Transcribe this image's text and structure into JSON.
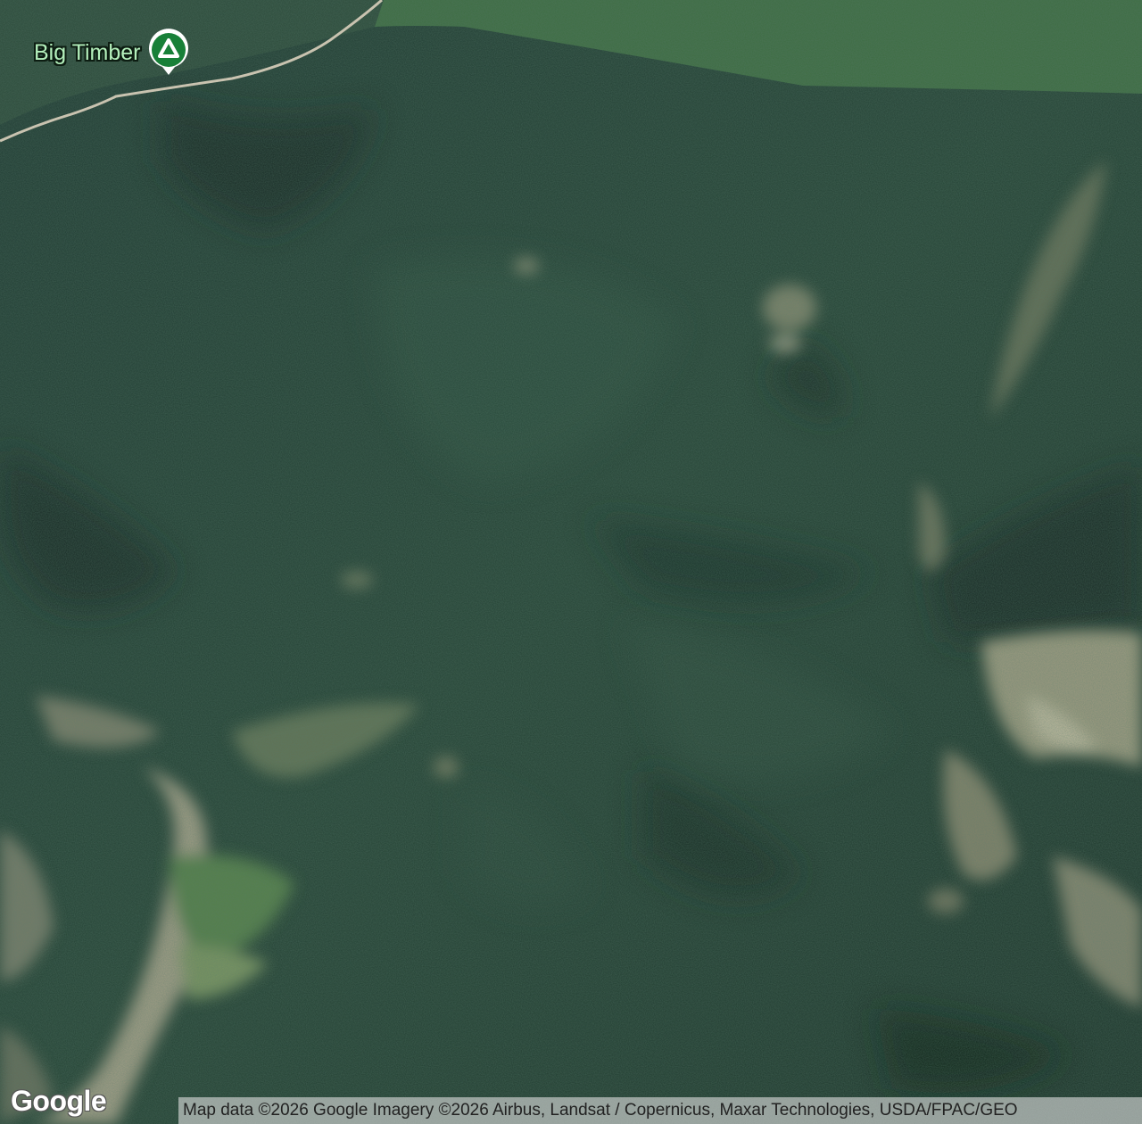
{
  "map": {
    "imagery_type": "satellite",
    "poi": {
      "label": "Big Timber",
      "icon": "campground-icon",
      "pin_color": "#188038"
    },
    "logo_text": "Google",
    "attribution": "Map data ©2026 Google Imagery ©2026 Airbus, Landsat / Copernicus, Maxar Technologies, USDA/FPAC/GEO",
    "colors": {
      "forest_dark": "#1f3a30",
      "forest_light": "#3a6a3c",
      "meadow": "#4e8a45",
      "rock": "#a8a48a",
      "road": "#c9c3b0"
    }
  }
}
